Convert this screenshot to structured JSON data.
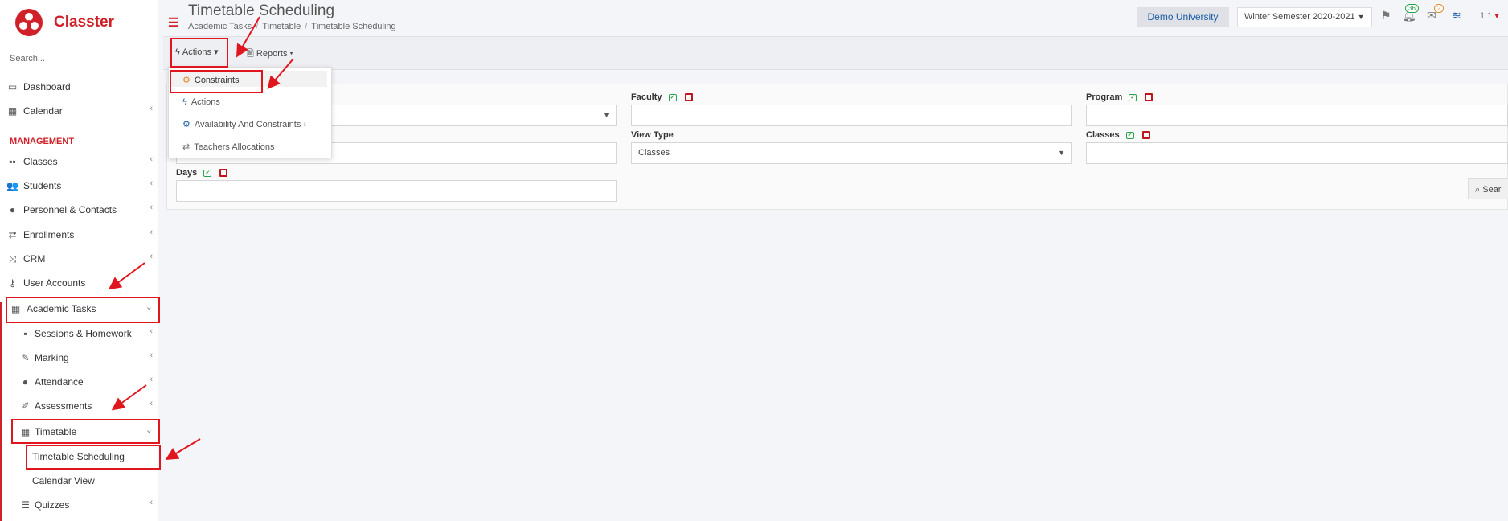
{
  "app": {
    "name": "Classter",
    "search_placeholder": "Search..."
  },
  "header": {
    "title": "Timetable Scheduling",
    "breadcrumb": [
      "Academic Tasks",
      "Timetable",
      "Timetable Scheduling"
    ],
    "institution": "Demo University",
    "semester": "Winter Semester 2020-2021",
    "notif_count": "36",
    "mail_count": "2",
    "user_short": "1 1"
  },
  "sidebar": {
    "dashboard": "Dashboard",
    "calendar": "Calendar",
    "section": "MANAGEMENT",
    "classes": "Classes",
    "students": "Students",
    "personnel": "Personnel & Contacts",
    "enrollments": "Enrollments",
    "crm": "CRM",
    "user_accounts": "User Accounts",
    "academic_tasks": "Academic Tasks",
    "sessions": "Sessions & Homework",
    "marking": "Marking",
    "attendance": "Attendance",
    "assessments": "Assessments",
    "timetable": "Timetable",
    "timetable_scheduling": "Timetable Scheduling",
    "calendar_view": "Calendar View",
    "quizzes": "Quizzes"
  },
  "toolbar": {
    "actions": "Actions",
    "reports": "Reports"
  },
  "dropdown": {
    "items": [
      "Constraints",
      "Actions",
      "Availability And Constraints",
      "Teachers Allocations"
    ]
  },
  "filters": {
    "faculty": "Faculty",
    "program": "Program",
    "view_type": "View Type",
    "view_type_value": "Classes",
    "classes": "Classes",
    "days": "Days",
    "search": "Sear"
  }
}
